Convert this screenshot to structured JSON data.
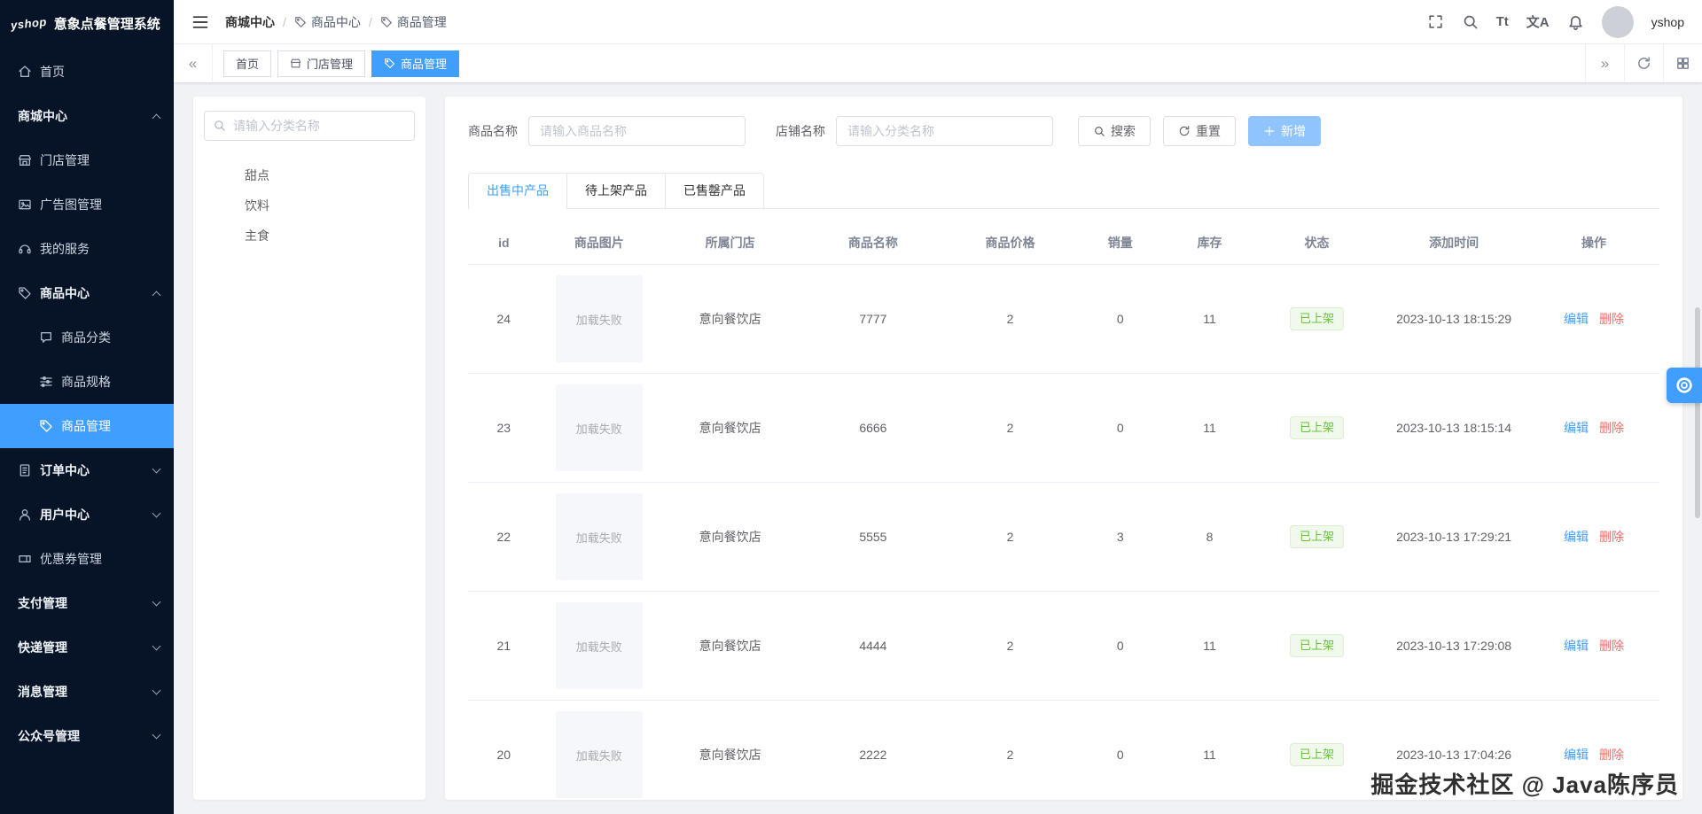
{
  "app": {
    "logo": "yshop",
    "title": "意象点餐管理系统",
    "username": "yshop"
  },
  "sidebar": {
    "items": [
      {
        "label": "首页"
      },
      {
        "label": "商城中心"
      },
      {
        "label": "门店管理"
      },
      {
        "label": "广告图管理"
      },
      {
        "label": "我的服务"
      },
      {
        "label": "商品中心"
      },
      {
        "label": "商品分类"
      },
      {
        "label": "商品规格"
      },
      {
        "label": "商品管理"
      },
      {
        "label": "订单中心"
      },
      {
        "label": "用户中心"
      },
      {
        "label": "优惠券管理"
      },
      {
        "label": "支付管理"
      },
      {
        "label": "快递管理"
      },
      {
        "label": "消息管理"
      },
      {
        "label": "公众号管理"
      }
    ]
  },
  "breadcrumb": {
    "separator": "/",
    "items": [
      {
        "label": "商城中心"
      },
      {
        "label": "商品中心"
      },
      {
        "label": "商品管理"
      }
    ]
  },
  "header_icons": {
    "text_size": "Tt",
    "translate": "文A"
  },
  "tags": {
    "prev": "«",
    "next": "»",
    "tabs": [
      {
        "label": "首页"
      },
      {
        "label": "门店管理"
      },
      {
        "label": "商品管理"
      }
    ]
  },
  "category_panel": {
    "search_placeholder": "请输入分类名称",
    "items": [
      {
        "label": "甜点"
      },
      {
        "label": "饮料"
      },
      {
        "label": "主食"
      }
    ]
  },
  "filters": {
    "product_name_label": "商品名称",
    "product_name_placeholder": "请输入商品名称",
    "store_name_label": "店铺名称",
    "store_name_placeholder": "请输入分类名称",
    "search_button": "搜索",
    "reset_button": "重置",
    "add_button": "新增"
  },
  "product_tabs": {
    "tabs": [
      {
        "label": "出售中产品"
      },
      {
        "label": "待上架产品"
      },
      {
        "label": "已售罄产品"
      }
    ]
  },
  "table": {
    "columns": {
      "id": "id",
      "image": "商品图片",
      "store": "所属门店",
      "name": "商品名称",
      "price": "商品价格",
      "sales": "销量",
      "stock": "库存",
      "status": "状态",
      "time": "添加时间",
      "ops": "操作"
    },
    "image_error_text": "加载失败",
    "edit_label": "编辑",
    "delete_label": "删除",
    "rows": [
      {
        "id": "24",
        "store": "意向餐饮店",
        "name": "7777",
        "price": "2",
        "sales": "0",
        "stock": "11",
        "status": "已上架",
        "time": "2023-10-13 18:15:29"
      },
      {
        "id": "23",
        "store": "意向餐饮店",
        "name": "6666",
        "price": "2",
        "sales": "0",
        "stock": "11",
        "status": "已上架",
        "time": "2023-10-13 18:15:14"
      },
      {
        "id": "22",
        "store": "意向餐饮店",
        "name": "5555",
        "price": "2",
        "sales": "3",
        "stock": "8",
        "status": "已上架",
        "time": "2023-10-13 17:29:21"
      },
      {
        "id": "21",
        "store": "意向餐饮店",
        "name": "4444",
        "price": "2",
        "sales": "0",
        "stock": "11",
        "status": "已上架",
        "time": "2023-10-13 17:29:08"
      },
      {
        "id": "20",
        "store": "意向餐饮店",
        "name": "2222",
        "price": "2",
        "sales": "0",
        "stock": "11",
        "status": "已上架",
        "time": "2023-10-13 17:04:26"
      }
    ]
  },
  "watermark": "掘金技术社区 @ Java陈序员",
  "colors": {
    "primary": "#409eff",
    "success": "#67c23a",
    "danger": "#f56c6c",
    "sidebar_bg": "#071427"
  }
}
